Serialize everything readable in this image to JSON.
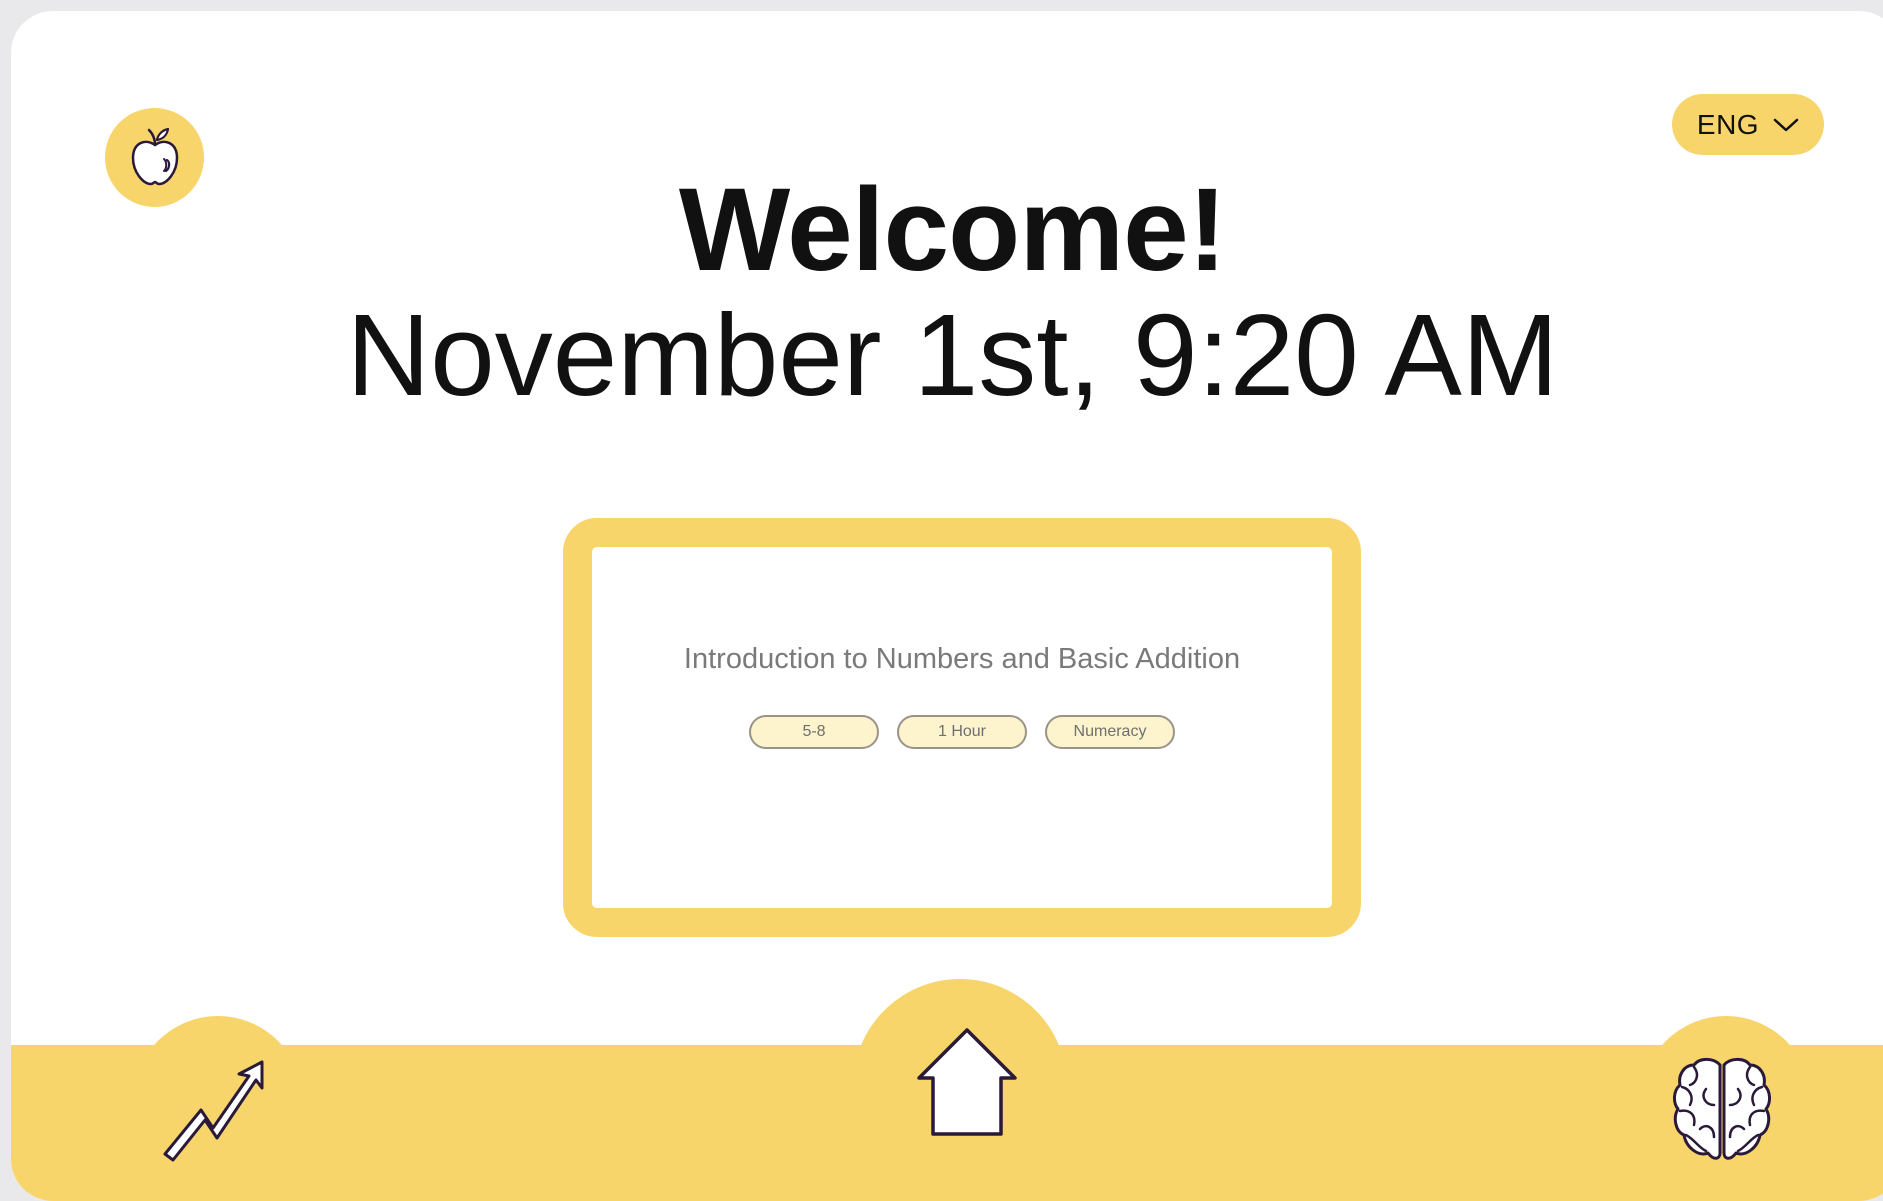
{
  "header": {
    "logo_icon": "apple-icon",
    "language": {
      "selected": "ENG",
      "icon": "chevron-down-icon"
    }
  },
  "greeting": {
    "title": "Welcome!",
    "datetime": "November 1st, 9:20 AM"
  },
  "lesson": {
    "title": "Introduction to Numbers and Basic Addition",
    "tags": [
      "5-8",
      "1 Hour",
      "Numeracy"
    ]
  },
  "nav": {
    "left_icon": "trending-up-arrow-icon",
    "center_icon": "home-icon",
    "right_icon": "brain-icon"
  },
  "colors": {
    "accent": "#f8d56b",
    "tag_fill": "#fdf3cd",
    "text": "#111111",
    "muted_text": "#7a7a7a",
    "icon_stroke": "#2a1a3a"
  }
}
